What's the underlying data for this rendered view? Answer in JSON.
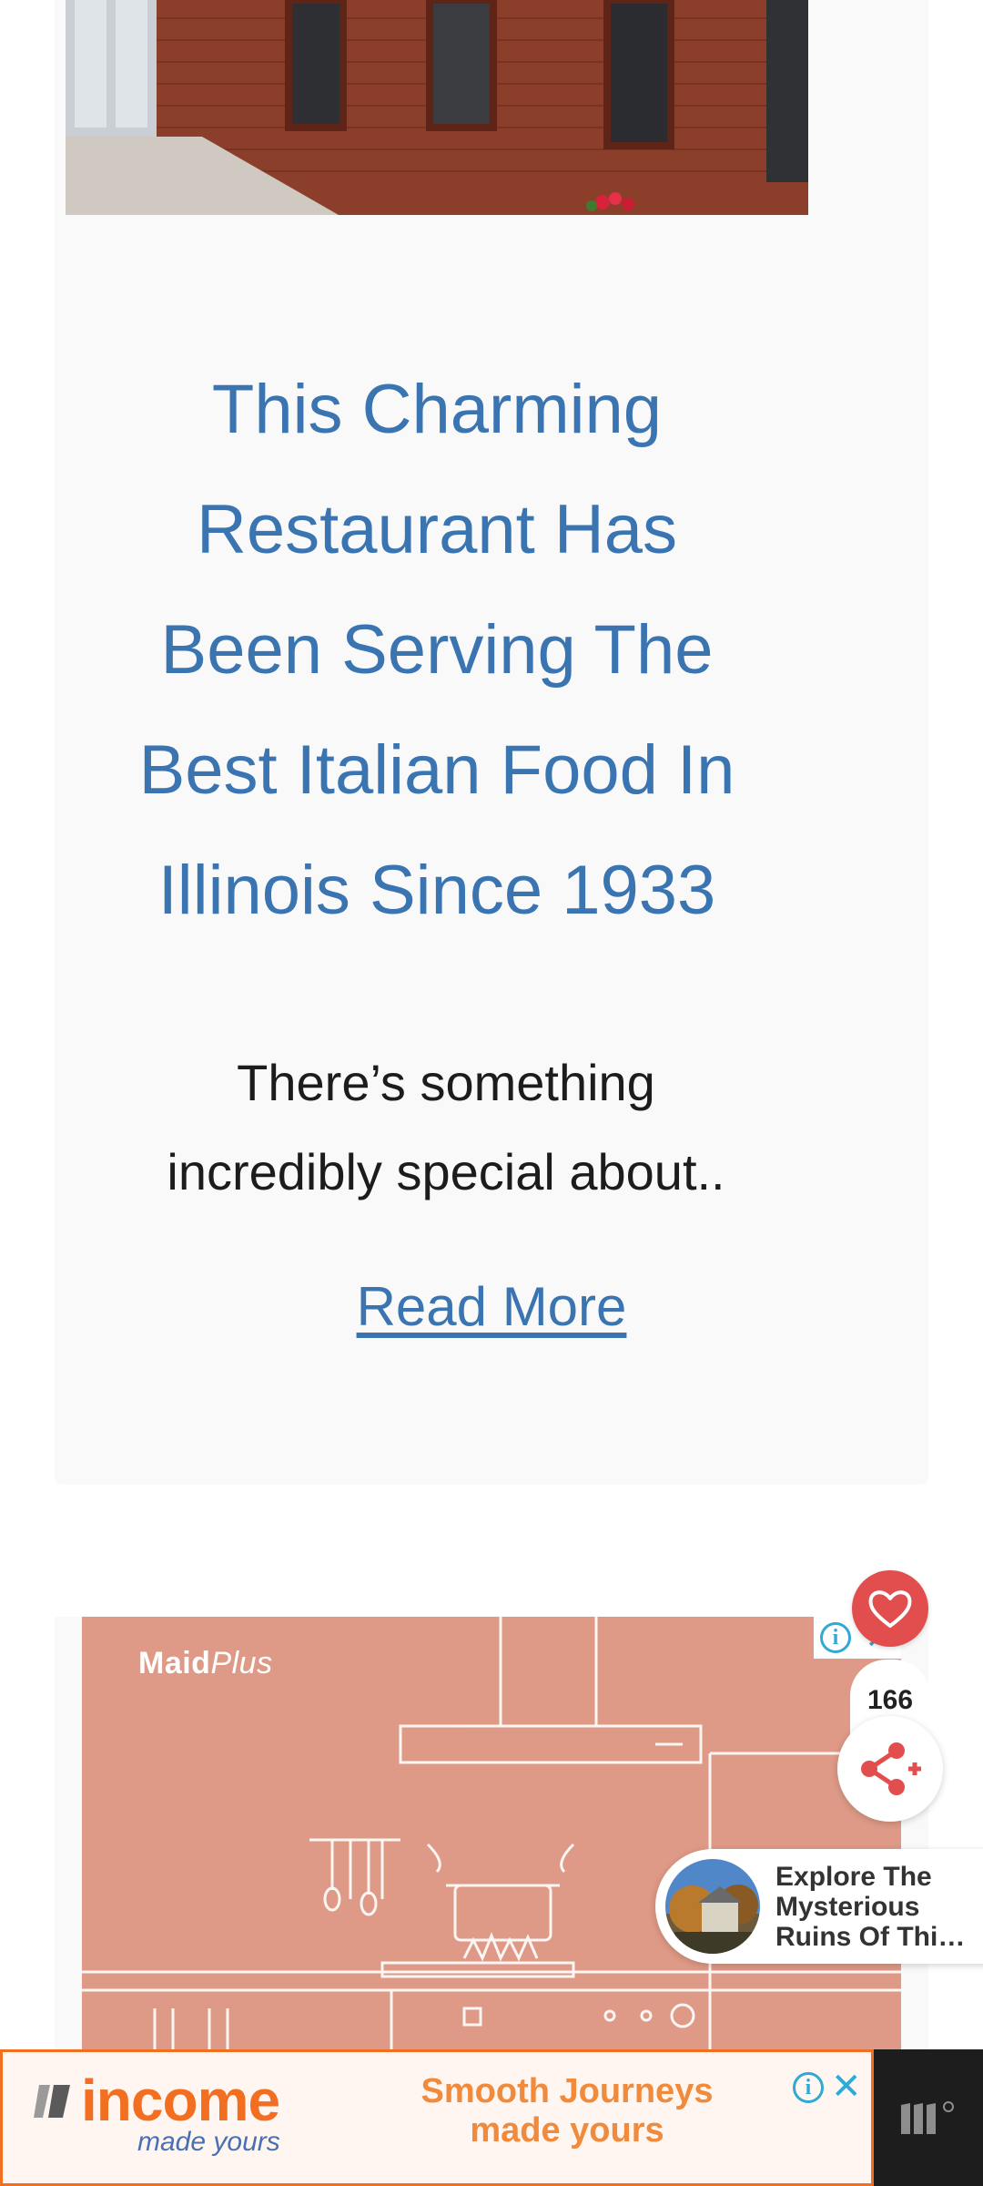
{
  "article": {
    "hero_alt": "brick-restaurant-storefront",
    "headline": "This Charming Restaurant Has Been Serving The Best Italian Food In Illinois Since 1933",
    "excerpt": "There’s something incredibly special about..",
    "read_more": "Read More"
  },
  "ad_maid": {
    "brand": "Maid",
    "brand_plus": "Plus",
    "info_glyph": "i",
    "close_glyph": "✕"
  },
  "floating": {
    "share_count": "166",
    "like_icon": "heart-icon",
    "share_icon": "share-icon"
  },
  "explore": {
    "text": "Explore The Mysterious Ruins Of Thi…"
  },
  "banner": {
    "logo_word": "income",
    "logo_sub": "made yours",
    "tagline_line1": "Smooth Journeys",
    "tagline_line2": "made yours",
    "info_glyph": "i",
    "close_glyph": "✕"
  },
  "colors": {
    "link_blue": "#3a74b1",
    "like_red": "#e24e4e",
    "ad_salmon": "#de9a86",
    "banner_orange": "#f26f22"
  }
}
